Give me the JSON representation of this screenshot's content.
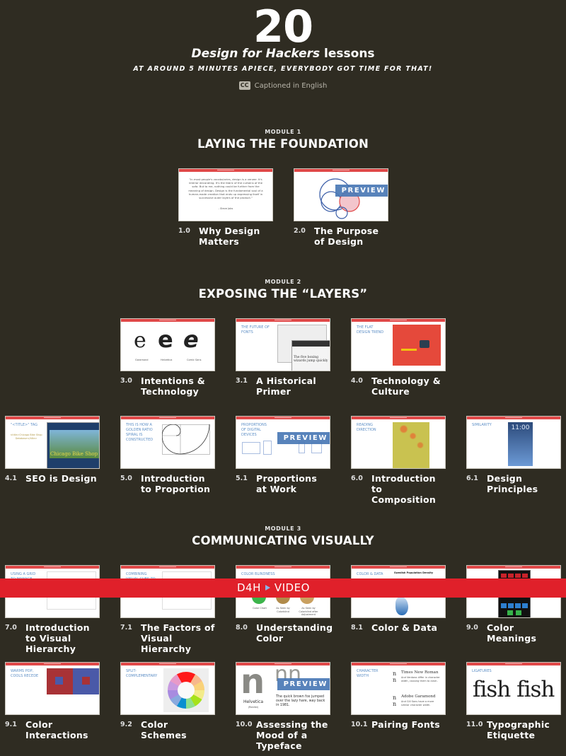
{
  "hero": {
    "count": "20",
    "title_em": "Design for Hackers",
    "title_rest": " lessons",
    "subtitle": "AT AROUND 5 MINUTES APIECE, EVERYBODY GOT TIME FOR THAT!",
    "caption_icon": "cc-icon",
    "caption_icon_text": "CC",
    "caption": "Captioned in English"
  },
  "modules": [
    {
      "label": "MODULE 1",
      "title": "LAYING THE FOUNDATION",
      "lessons": [
        {
          "num": "1.0",
          "title": "Why Design Matters",
          "thumb_label": "",
          "quote": "\"In most people's vocabularies, design is a veneer. It's interior decorating. It's the fabric of the curtains of the sofa. But to me, nothing could be further from the meaning of design. Design is the fundamental soul of a human-made creation that ends up expressing itself in successive outer layers of the product.\"",
          "quote_author": "- Steve Jobs"
        },
        {
          "num": "2.0",
          "title": "The Purpose of Design",
          "preview": "PREVIEW"
        }
      ]
    },
    {
      "label": "MODULE 2",
      "title": "EXPOSING THE “LAYERS”",
      "lessons": [
        {
          "num": "3.0",
          "title": "Intentions & Technology",
          "captions": [
            "Garamond",
            "Helvetica",
            "Comic Sans"
          ]
        },
        {
          "num": "3.1",
          "title": "A Historical Primer",
          "thumb_label": "THE FUTURE OF FONTS",
          "sample": "The five boxing wizards jump quickly"
        },
        {
          "num": "4.0",
          "title": "Technology & Culture",
          "thumb_label": "THE FLAT DESIGN TREND"
        },
        {
          "num": "4.1",
          "title": "SEO is Design",
          "thumb_label": "\"<TITLE>\" TAG",
          "code": "<title>Chicago Bike Shop Database</title>",
          "site": "Chicago Bike Shop Database"
        },
        {
          "num": "5.0",
          "title": "Introduction to Proportion",
          "thumb_label": "THIS IS HOW A GOLDEN RATIO SPIRAL IS CONSTRUCTED"
        },
        {
          "num": "5.1",
          "title": "Proportions at Work",
          "thumb_label": "PROPORTIONS OF DIGITAL DEVICES",
          "preview": "PREVIEW"
        },
        {
          "num": "6.0",
          "title": "Introduction to Composition",
          "thumb_label": "READING DIRECTION"
        },
        {
          "num": "6.1",
          "title": "Design Principles",
          "thumb_label": "SIMILARITY",
          "clock": "11:00"
        }
      ]
    },
    {
      "label": "MODULE 3",
      "title": "COMMUNICATING VISUALLY",
      "lessons": [
        {
          "num": "7.0",
          "title": "Introduction to Visual Hierarchy",
          "thumb_label": "USING A GRID TO MANAGE IMAGES"
        },
        {
          "num": "7.1",
          "title": "The Factors of Visual Hierarchy",
          "thumb_label": "COMBINING VISUAL CUES TO"
        },
        {
          "num": "8.0",
          "title": "Understanding Color",
          "thumb_label": "COLOR BLINDNESS",
          "captions": [
            "Color Chart",
            "As Seen by Colorblind",
            "As Seen by Colorblind after Adjustment"
          ]
        },
        {
          "num": "8.1",
          "title": "Color & Data",
          "thumb_label": "COLOR & DATA",
          "chart_title": "Swedish Population Density"
        },
        {
          "num": "9.0",
          "title": "Color Meanings"
        },
        {
          "num": "9.1",
          "title": "Color Interactions",
          "thumb_label": "WARMS POP, COOLS RECEDE"
        },
        {
          "num": "9.2",
          "title": "Color Schemes",
          "thumb_label": "SPLIT-COMPLEMENTARY"
        },
        {
          "num": "10.0",
          "title": "Assessing the Mood of a Typeface",
          "font_name": "Helvetica",
          "font_sub": "(Realist)",
          "sample": "The quick brown fox jumped over the lazy hare, way back in 1981.",
          "preview": "PREVIEW"
        },
        {
          "num": "10.1",
          "title": "Pairing Fonts",
          "thumb_label": "CHARACTER WIDTH",
          "font_a": "Times New Roman",
          "font_a_note": "And Verdana differ in character width, causing them to clash.",
          "font_b": "Adobe Garamond",
          "font_b_note": "And Gill Sans have a more similar character width."
        },
        {
          "num": "11.0",
          "title": "Typographic Etiquette",
          "thumb_label": "LIGATURES",
          "ligature_text": "fish fish"
        }
      ]
    }
  ],
  "video_banner": {
    "brand": "D4H",
    "icon": "play-icon",
    "label": "VIDEO"
  },
  "colors": {
    "background": "#2f2c22",
    "accent_red": "#e0202a",
    "preview_blue": "#4a79b6",
    "label_blue": "#5e8fc6"
  }
}
